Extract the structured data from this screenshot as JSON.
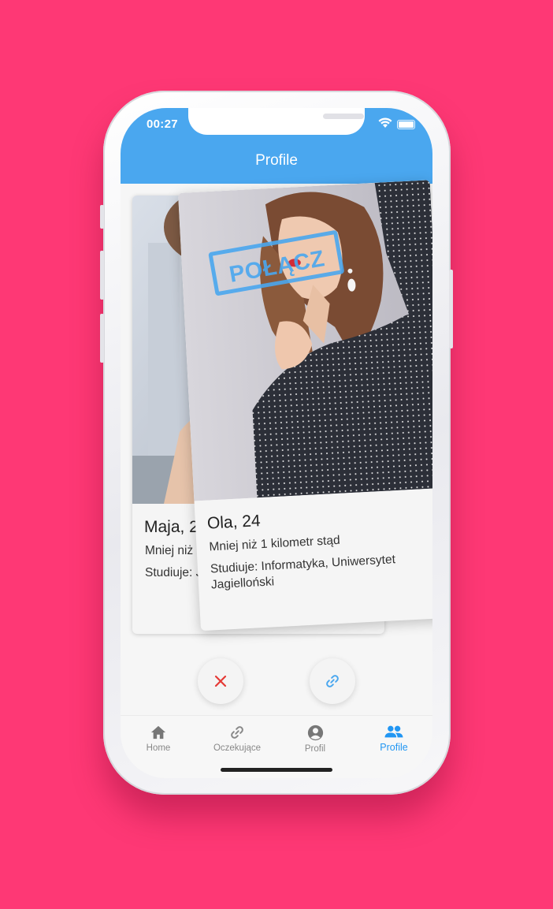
{
  "status_bar": {
    "time": "00:27"
  },
  "app_bar": {
    "title": "Profile"
  },
  "cards": {
    "back": {
      "name": "Maja, 2",
      "distance": "Mniej niż",
      "study": "Studiuje: Jagielloński"
    },
    "front": {
      "name": "Ola, 24",
      "distance": "Mniej niż 1 kilometr stąd",
      "study": "Studiuje: Informatyka, Uniwersytet Jagielloński",
      "stamp": "POŁĄCZ"
    }
  },
  "actions": {
    "reject_icon": "close-icon",
    "connect_icon": "link-icon"
  },
  "bottom_nav": {
    "items": [
      {
        "label": "Home",
        "icon": "home-icon"
      },
      {
        "label": "Oczekujące",
        "icon": "link-icon"
      },
      {
        "label": "Profil",
        "icon": "account-circle-icon"
      },
      {
        "label": "Profile",
        "icon": "people-icon",
        "active": true
      }
    ]
  },
  "colors": {
    "background": "#fe3875",
    "primary": "#4aa7ef",
    "active_nav": "#2196f3",
    "reject": "#e53935"
  }
}
